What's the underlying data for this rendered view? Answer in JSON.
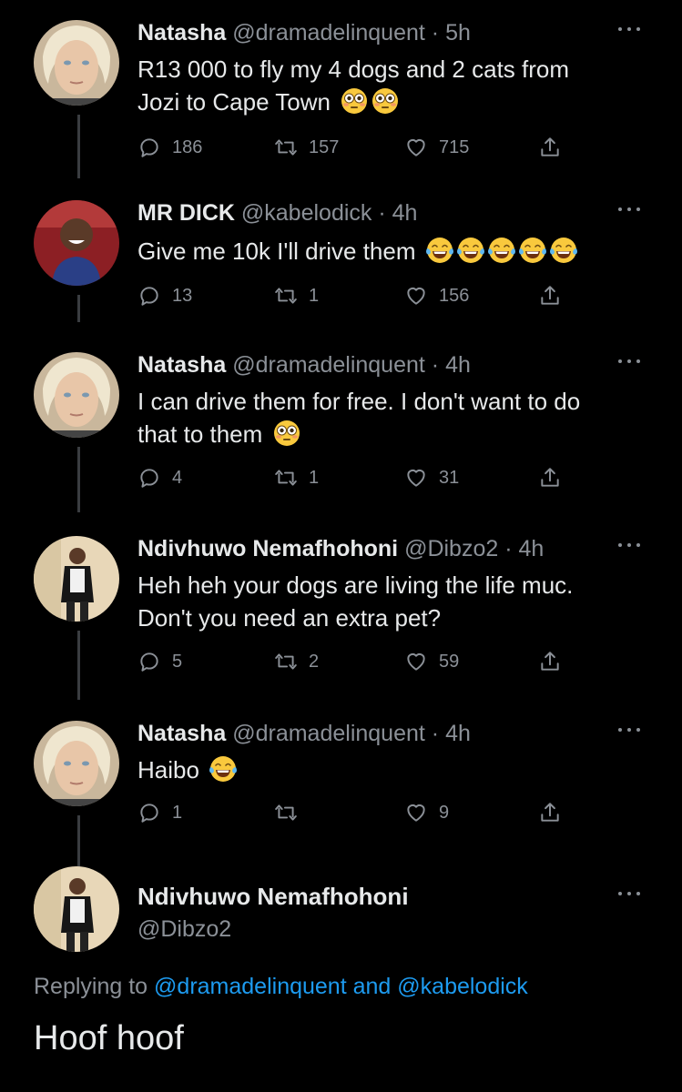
{
  "tweets": [
    {
      "name": "Natasha",
      "handle": "@dramadelinquent",
      "dot": "·",
      "time": "5h",
      "text_line1": "R13 000 to fly my 4 dogs and 2 cats from",
      "text_line2": "Jozi to Cape Town",
      "emojis": [
        "flushed-face",
        "flushed-face"
      ],
      "replies": "186",
      "retweets": "157",
      "likes": "715",
      "avatar": "woman-avatar"
    },
    {
      "name": "MR DICK",
      "handle": "@kabelodick",
      "dot": "·",
      "time": "4h",
      "text_line1": "Give me 10k I'll drive them",
      "emojis": [
        "tears-of-joy",
        "tears-of-joy",
        "tears-of-joy",
        "tears-of-joy",
        "tears-of-joy"
      ],
      "replies": "13",
      "retweets": "1",
      "likes": "156",
      "avatar": "man-red-avatar"
    },
    {
      "name": "Natasha",
      "handle": "@dramadelinquent",
      "dot": "·",
      "time": "4h",
      "text_line1": "I can drive them for free. I don't want to do",
      "text_line2": "that to them",
      "emojis": [
        "flushed-face"
      ],
      "replies": "4",
      "retweets": "1",
      "likes": "31",
      "avatar": "woman-avatar"
    },
    {
      "name": "Ndivhuwo Nemafhohoni",
      "handle": "@Dibzo2",
      "dot": "·",
      "time": "4h",
      "text_line1": "Heh heh your dogs are living the life muc.",
      "text_line2": "Don't you need an extra pet?",
      "replies": "5",
      "retweets": "2",
      "likes": "59",
      "avatar": "man-standing-avatar"
    },
    {
      "name": "Natasha",
      "handle": "@dramadelinquent",
      "dot": "·",
      "time": "4h",
      "text_line1": "Haibo",
      "emojis": [
        "tears-of-joy"
      ],
      "replies": "1",
      "retweets": "",
      "likes": "9",
      "avatar": "woman-avatar"
    }
  ],
  "final": {
    "name": "Ndivhuwo Nemafhohoni",
    "handle": "@Dibzo2",
    "replying_prefix": "Replying to",
    "replying_user1": "@dramadelinquent",
    "replying_and": "and",
    "replying_user2": "@kabelodick",
    "text": "Hoof hoof",
    "avatar": "man-standing-avatar"
  },
  "icons": {
    "reply": "reply-icon",
    "retweet": "retweet-icon",
    "like": "heart-icon",
    "share": "share-icon",
    "more": "more-icon"
  },
  "colors": {
    "background": "#000000",
    "text": "#e7e9ea",
    "secondary": "#8b9097",
    "link": "#1d9bf0"
  }
}
